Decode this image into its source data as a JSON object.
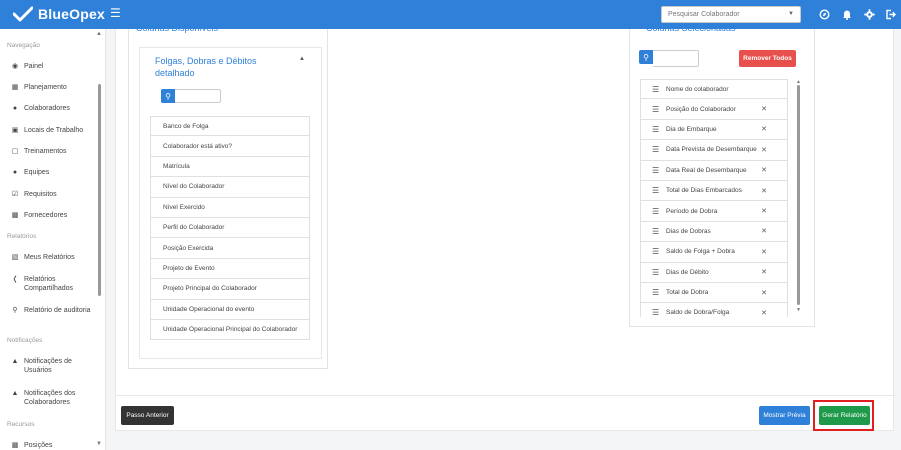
{
  "header": {
    "brand": "BlueOpex",
    "menu_icon": "hamburger-icon",
    "search_placeholder": "Pesquisar Colaborador",
    "icons": [
      "compass-icon",
      "bell-icon",
      "gear-icon",
      "logout-icon"
    ]
  },
  "sidebar": {
    "sections": {
      "navegacao": "Navegação",
      "relatorios": "Relatórios",
      "notificacoes": "Notificações",
      "recursos": "Recursos"
    },
    "items": [
      {
        "label": "Painel",
        "icon": "dashboard-icon"
      },
      {
        "label": "Planejamento",
        "icon": "calendar-icon"
      },
      {
        "label": "Colaboradores",
        "icon": "users-icon"
      },
      {
        "label": "Locais de Trabalho",
        "icon": "building-icon"
      },
      {
        "label": "Treinamentos",
        "icon": "training-icon"
      },
      {
        "label": "Equipes",
        "icon": "team-icon"
      },
      {
        "label": "Requisitos",
        "icon": "checkbox-icon"
      },
      {
        "label": "Fornecedores",
        "icon": "briefcase-icon"
      },
      {
        "label": "Meus Relatórios",
        "icon": "print-icon"
      },
      {
        "label": "Relatórios Compartilhados",
        "icon": "share-icon"
      },
      {
        "label": "Relatório de auditoria",
        "icon": "audit-icon"
      },
      {
        "label": "Notificações de Usuários",
        "icon": "bell-icon"
      },
      {
        "label": "Notificações dos Colaboradores",
        "icon": "bell-icon"
      },
      {
        "label": "Posições",
        "icon": "positions-icon"
      }
    ]
  },
  "available": {
    "title": "Colunas Disponíveis",
    "group_title": "Folgas, Dobras e Débitos detalhado",
    "items": [
      "Banco de Folga",
      "Colaborador está ativo?",
      "Matrícula",
      "Nível do Colaborador",
      "Nível Exercido",
      "Perfil do Colaborador",
      "Posição Exercida",
      "Projeto de Evento",
      "Projeto Principal do Colaborador",
      "Unidade Operacional do evento",
      "Unidade Operacional Principal do Colaborador"
    ]
  },
  "selected": {
    "title": "Colunas Selecionadas",
    "remove_all_label": "Remover Todos",
    "items": [
      {
        "label": "Nome do colaborador",
        "removable": false
      },
      {
        "label": "Posição do Colaborador",
        "removable": true
      },
      {
        "label": "Dia de Embarque",
        "removable": true
      },
      {
        "label": "Data Prevista de Desembarque",
        "removable": true
      },
      {
        "label": "Data Real de Desembarque",
        "removable": true
      },
      {
        "label": "Total de Dias Embarcados",
        "removable": true
      },
      {
        "label": "Período de Dobra",
        "removable": true
      },
      {
        "label": "Dias de Dobras",
        "removable": true
      },
      {
        "label": "Saldo de Folga + Dobra",
        "removable": true
      },
      {
        "label": "Dias de Débito",
        "removable": true
      },
      {
        "label": "Total de Dobra",
        "removable": true
      },
      {
        "label": "Saldo de Dobra/Folga",
        "removable": true
      }
    ]
  },
  "footer": {
    "prev_label": "Passo Anterior",
    "preview_label": "Mostrar Prévia",
    "generate_label": "Gerar Relatório"
  },
  "colors": {
    "primary": "#2f80d8",
    "danger": "#e8504d",
    "success": "#1f9a4a",
    "dark": "#333333",
    "highlight": "#e02020"
  }
}
